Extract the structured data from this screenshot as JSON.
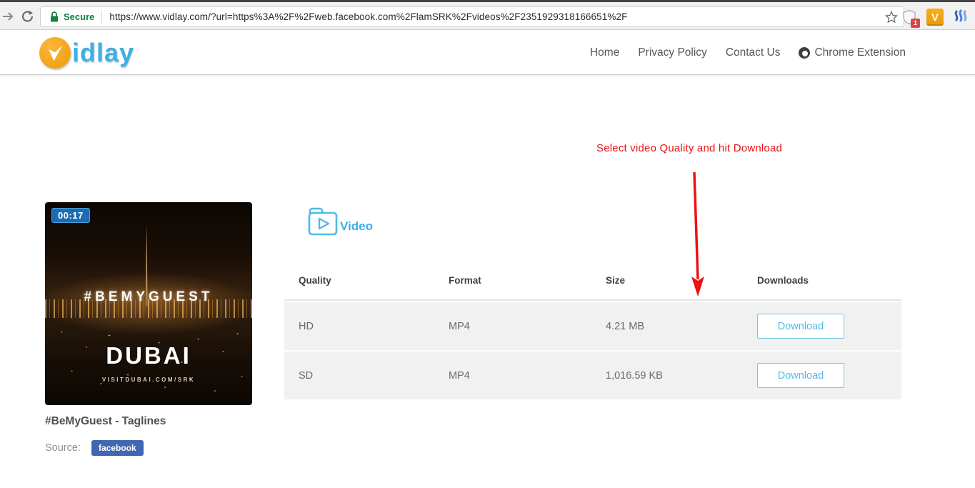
{
  "browser": {
    "secure_label": "Secure",
    "url": "https://www.vidlay.com/?url=https%3A%2F%2Fweb.facebook.com%2FlamSRK%2Fvideos%2F2351929318166651%2F",
    "extension_v_label": "V",
    "extension_badge_count": "1"
  },
  "header": {
    "logo_text": "idlay",
    "nav": [
      {
        "label": "Home"
      },
      {
        "label": "Privacy Policy"
      },
      {
        "label": "Contact Us"
      },
      {
        "label": "Chrome Extension"
      }
    ]
  },
  "annotation": {
    "text": "Select video Quality and hit Download",
    "color": "#ea1212"
  },
  "video": {
    "duration": "00:17",
    "overlay_hashtag": "#BEMYGUEST",
    "overlay_brand": "DUBAI",
    "overlay_url": "VISITDUBAI.COM/SRK",
    "title": "#BeMyGuest - Taglines",
    "source_label": "Source:",
    "source_badge": "facebook"
  },
  "downloads": {
    "section_label": "Video",
    "columns": [
      "Quality",
      "Format",
      "Size",
      "Downloads"
    ],
    "rows": [
      {
        "quality": "HD",
        "format": "MP4",
        "size": "4.21 MB",
        "action": "Download"
      },
      {
        "quality": "SD",
        "format": "MP4",
        "size": "1,016.59 KB",
        "action": "Download"
      }
    ]
  },
  "colors": {
    "accent_blue": "#3cafe4",
    "logo_orange": "#f2a615",
    "facebook_blue": "#4267b2",
    "annotation_red": "#ea1212",
    "secure_green": "#0b8043",
    "row_gray": "#f1f1f1"
  }
}
